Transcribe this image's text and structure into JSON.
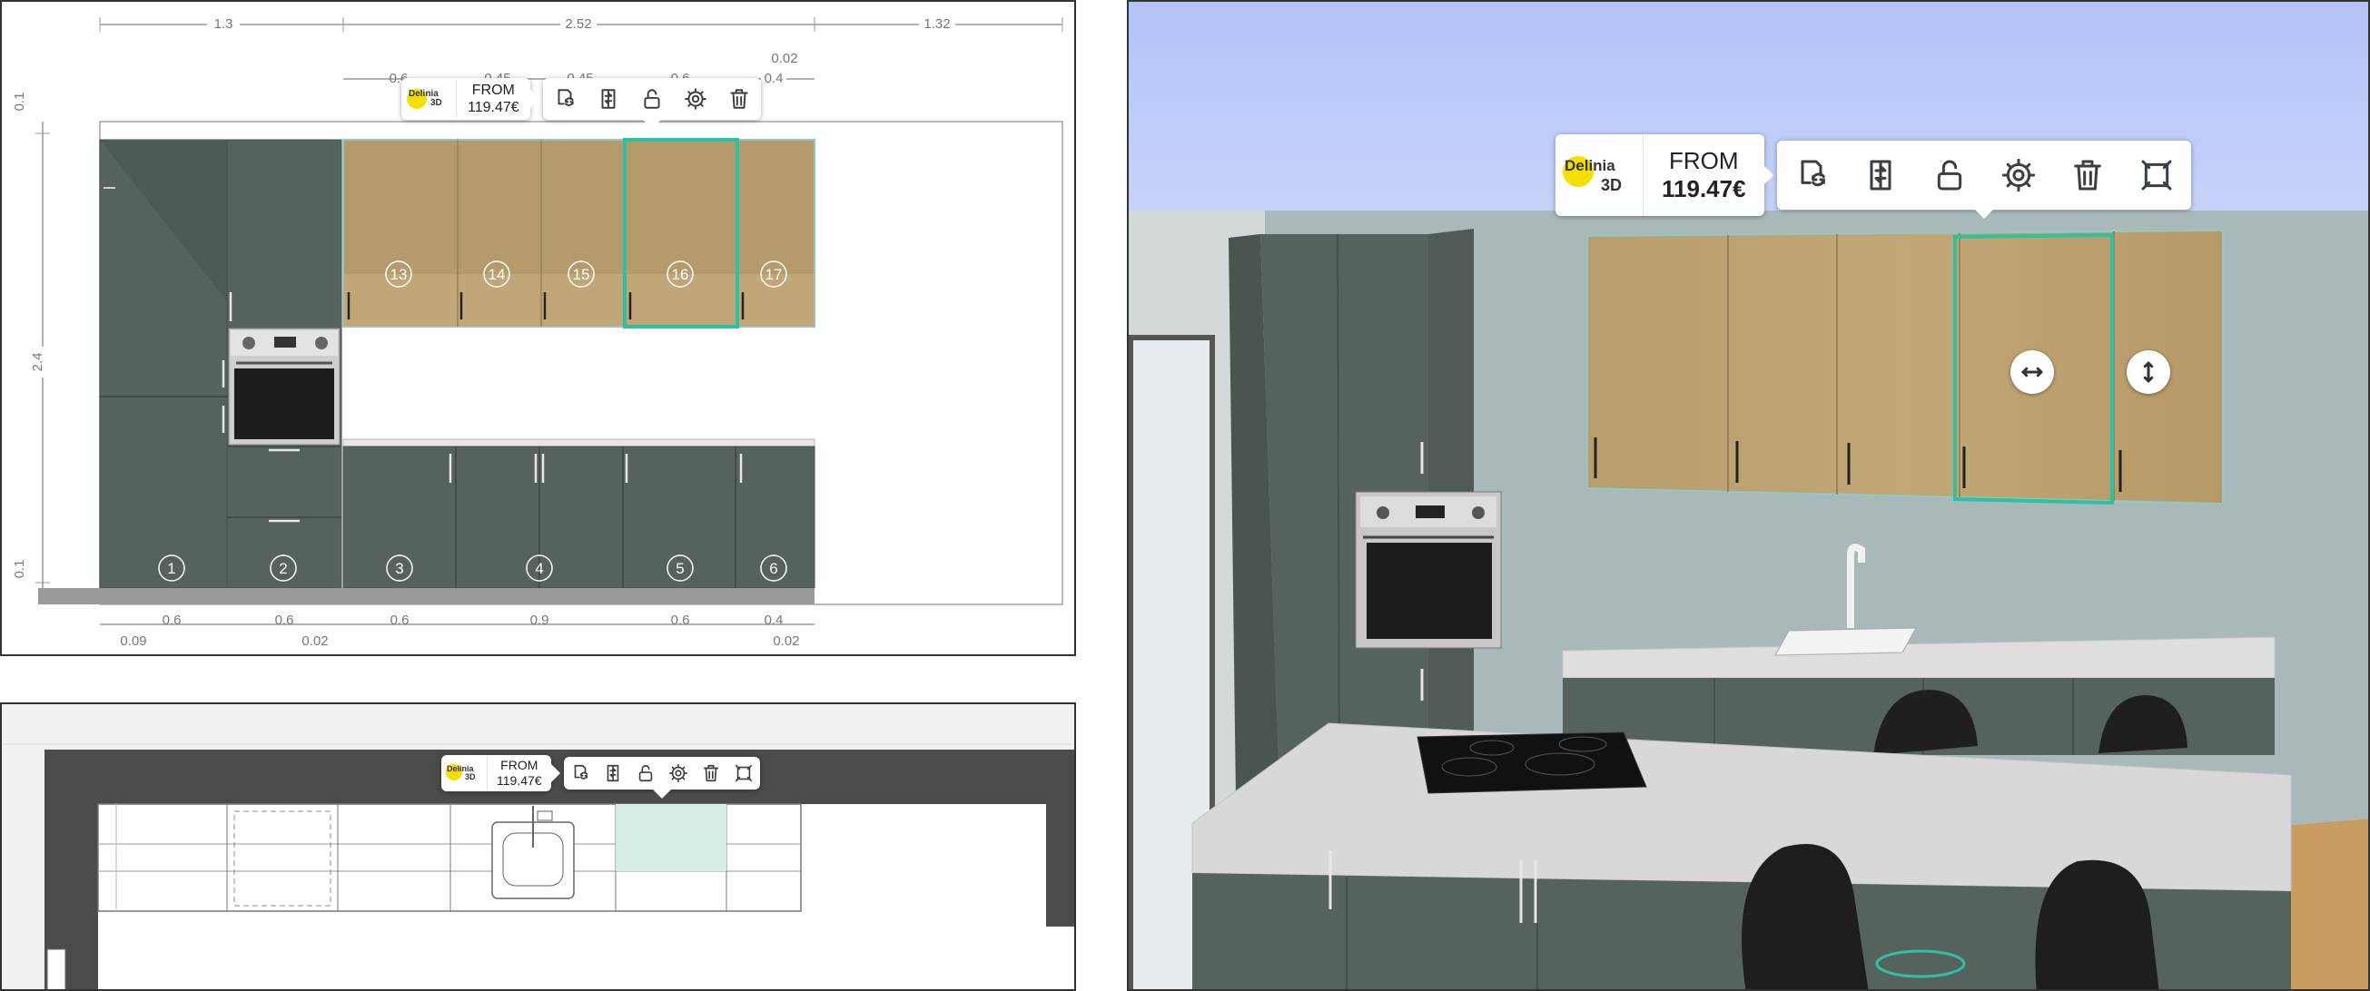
{
  "colors": {
    "cabinet": "#56625c",
    "cabinet_dark": "#4b5650",
    "oak": "#b59a6c",
    "highlight": "#2ec1a1",
    "brand_yellow": "#f4e000",
    "sky": "#b6c6f8",
    "wall": "#a8b8b8",
    "floor": "#c99c62",
    "counter": "#dcdcdc"
  },
  "popup": {
    "brand": "Delinia",
    "brand_suffix": "3D",
    "price_prefix": "FROM",
    "price": "119.47€",
    "tools": [
      {
        "icon": "replace-icon",
        "name": "replace"
      },
      {
        "icon": "swap-side-icon",
        "name": "swap"
      },
      {
        "icon": "unlock-icon",
        "name": "lock"
      },
      {
        "icon": "gear-icon",
        "name": "settings"
      },
      {
        "icon": "trash-icon",
        "name": "delete"
      },
      {
        "icon": "fullscreen-icon",
        "name": "resize"
      }
    ]
  },
  "front_view": {
    "top_dims": [
      "1.3",
      "2.52",
      "1.32"
    ],
    "sub_dims": [
      "0.6",
      "0.45",
      "0.45",
      "0.6",
      "0.4",
      "0.02"
    ],
    "left_dims": [
      "0.1",
      "2.4",
      "0.1"
    ],
    "bottom_dims": [
      "0.6",
      "0.6",
      "0.6",
      "0.9",
      "0.6",
      "0.4"
    ],
    "bottom_small": [
      "0.09",
      "0.02",
      "0.02"
    ],
    "upper_numbers": [
      "13",
      "14",
      "15",
      "16",
      "17"
    ],
    "lower_numbers": [
      "1",
      "2",
      "3",
      "4",
      "5",
      "6"
    ]
  },
  "view3d": {
    "move_horizontal": "move-horizontal-icon",
    "move_vertical": "move-vertical-icon"
  }
}
